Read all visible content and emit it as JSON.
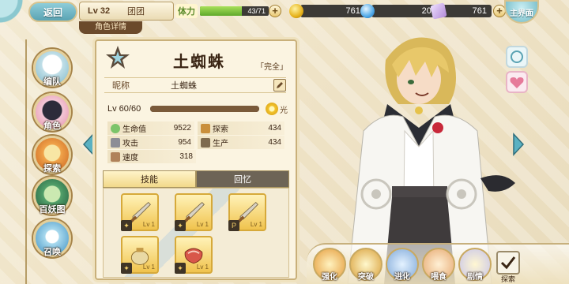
{
  "top_bar": {
    "back_label": "返回",
    "level": "Lv 32",
    "group": "团团",
    "stamina_label": "体力",
    "stamina_text": "43/71",
    "stamina_fraction": 0.61,
    "gold": "7616",
    "crystal": "202",
    "ticket": "761",
    "main_label": "主界面",
    "sub_title": "角色详情"
  },
  "sidebar": {
    "formation": "编队",
    "character": "角色",
    "explore": "探索",
    "yokai": "百妖图",
    "summon": "召唤"
  },
  "card": {
    "name": "土蜘蛛",
    "complete_tag": "「完全」",
    "nick_key": "昵称",
    "nick_value": "土蜘蛛",
    "level_text": "Lv 60/60",
    "level_fraction": 1.0,
    "element": "光",
    "stats": [
      {
        "key": "生命值",
        "value": "9522"
      },
      {
        "key": "探索",
        "value": "434"
      },
      {
        "key": "攻击",
        "value": "954"
      },
      {
        "key": "生产",
        "value": "434"
      },
      {
        "key": "速度",
        "value": "318"
      }
    ],
    "tabs": {
      "skills": "技能",
      "memory": "回忆"
    },
    "skill_levels": [
      "Lv 1",
      "Lv 1",
      "Lv 1",
      "Lv 1",
      "Lv 1"
    ]
  },
  "actions": {
    "enhance": "强化",
    "breakthrough": "突破",
    "evolve": "进化",
    "feed": "喂食",
    "story": "剧情",
    "select": "探索"
  },
  "colors": {
    "accent_gold": "#e6b21b",
    "stamina_green": "#5fa92b",
    "panel_brown": "#6b4a2b"
  }
}
